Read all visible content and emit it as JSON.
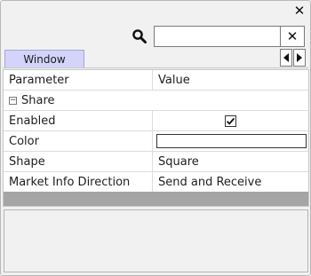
{
  "window": {
    "close_glyph": "✕"
  },
  "search": {
    "value": "",
    "placeholder": "",
    "clear_glyph": "✕",
    "icon": "search-icon"
  },
  "tabs": [
    {
      "label": "Window",
      "active": true
    }
  ],
  "tab_scroll": {
    "left_icon": "triangle-left-icon",
    "right_icon": "triangle-right-icon"
  },
  "grid": {
    "headers": {
      "parameter": "Parameter",
      "value": "Value"
    },
    "section": {
      "label": "Share",
      "expanded": true,
      "expander_glyph": "−"
    },
    "rows": [
      {
        "parameter": "Enabled",
        "value_type": "checkbox",
        "checked": true
      },
      {
        "parameter": "Color",
        "value_type": "color",
        "color": "#ffffff"
      },
      {
        "parameter": "Shape",
        "value_type": "text",
        "value": "Square"
      },
      {
        "parameter": "Market Info Direction",
        "value_type": "text",
        "value": "Send and Receive"
      }
    ]
  },
  "description": {
    "text": ""
  },
  "colors": {
    "tab_active": "#d4d4fb",
    "selection_bar": "#a5a5a5",
    "panel_bg": "#f1f1f1"
  }
}
